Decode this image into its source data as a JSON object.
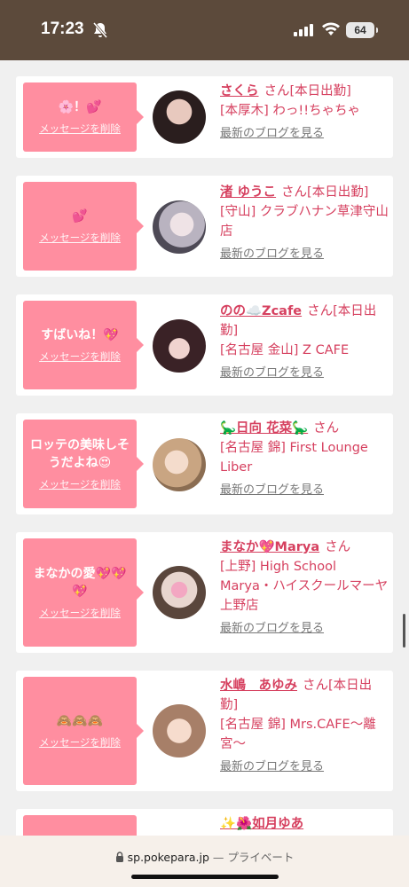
{
  "status_bar": {
    "time": "17:23",
    "battery": "64"
  },
  "cards": [
    {
      "message": "🌸！💕",
      "delete_label": "メッセージを削除",
      "name": "さくら",
      "suffix": "さん[本日出勤]",
      "shop": "[本厚木] わっ!!ちゃちゃ",
      "blog_label": "最新のブログを見る"
    },
    {
      "message": "💕",
      "delete_label": "メッセージを削除",
      "name": "渚 ゆうこ",
      "suffix": "さん[本日出勤]",
      "shop": "[守山] クラブハナン草津守山店",
      "blog_label": "最新のブログを見る"
    },
    {
      "message": "すばいね！💖",
      "delete_label": "メッセージを削除",
      "name": "のの☁️Zcafe",
      "suffix": "さん[本日出勤]",
      "shop": "[名古屋 金山] Z CAFE",
      "blog_label": "最新のブログを見る"
    },
    {
      "message": "ロッテの美味しそうだよね😍",
      "delete_label": "メッセージを削除",
      "name": "🦕日向 花菜🦕",
      "suffix": "さん",
      "shop": "[名古屋 錦] First Lounge Liber",
      "blog_label": "最新のブログを見る"
    },
    {
      "message": "まなかの愛💖💖💖",
      "delete_label": "メッセージを削除",
      "name": "まなか💖Marya",
      "suffix": "さん",
      "shop": "[上野] High School Marya・ハイスクールマーヤ上野店",
      "blog_label": "最新のブログを見る"
    },
    {
      "message": "🙈🙈🙈",
      "delete_label": "メッセージを削除",
      "name": "水嶋　あゆみ",
      "suffix": "さん[本日出勤]",
      "shop": "[名古屋 錦] Mrs.CAFE〜離宮〜",
      "blog_label": "最新のブログを見る"
    },
    {
      "message": "",
      "delete_label": "",
      "name": "✨🌺如月ゆあ",
      "suffix": "",
      "shop": "",
      "blog_label": ""
    }
  ],
  "browser": {
    "domain": "sp.pokepara.jp",
    "privacy": "— プライベート"
  },
  "colors": {
    "status_bar": "#5c4a3b",
    "bubble": "#ff8ea0",
    "name_text": "#d6405f"
  }
}
